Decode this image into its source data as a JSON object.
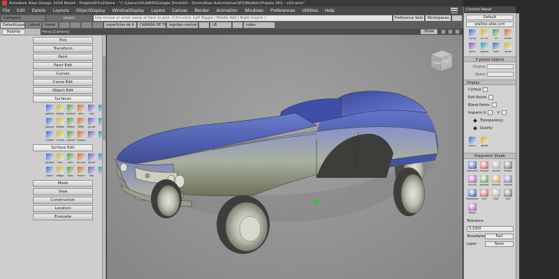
{
  "window": {
    "title": "Autodesk Alias Design 2016 Beta4  -  ProjetoSP2v20wire : \"C:\\Users\\USUARIO\\Google Drive\\00 - Quim\\Alias Automotive\\SP2\\Modelo\\Projeto SP2 - v20.wire\""
  },
  "menu": [
    "File",
    "Edit",
    "Delete",
    "Layouts",
    "ObjectDisplay",
    "WindowDisplay",
    "Layers",
    "Canvas",
    "Render",
    "Animation",
    "Windows",
    "Preferences",
    "Utilities",
    "Help"
  ],
  "toolbar": {
    "category": "Category",
    "object": "object",
    "command_hint": "Use mouse or enter name of item to pick. (Ctrl+click: Left Toggle  | Middle Add | Right Unpick )",
    "preference_sets": "Preference Sets",
    "workspaces": "Workspaces"
  },
  "shelves": [
    "DefaultLayer",
    "Lateral",
    "frente",
    "",
    "",
    "",
    "",
    "superficies da fr",
    "CAMADA DE TRI",
    "logotipo central",
    "",
    "LB",
    "",
    "rodas"
  ],
  "viewport": {
    "label": "Persp [Camera]",
    "show": "Show",
    "cube_labels": [
      "RIGHT",
      "LEFT"
    ]
  },
  "palette": {
    "title": "Palette",
    "sections_top": [
      "Pick",
      "Transform",
      "Paint",
      "Paint Edit",
      "Curves",
      "Curve Edit",
      "Object Edit"
    ],
    "surfaces": {
      "title": "Surfaces",
      "tools": [
        "sphere",
        "planar",
        "revolve",
        "skin",
        "rail",
        "",
        "square",
        "sftillet",
        "fillflnd",
        "fillfln",
        "round",
        "",
        "msdrft",
        "crvnet",
        "cmbsrf",
        "srvpns",
        "",
        ""
      ]
    },
    "surface_edit": {
      "title": "Surface Edit",
      "tools": [
        "project",
        "trim",
        "stch",
        "sh sub",
        "jdhull",
        "",
        "adsrf",
        "ofalgn",
        "tstsr",
        "revsrv",
        "stb",
        ""
      ]
    },
    "sections_bottom": [
      "Mesh",
      "View",
      "Construction",
      "Locators",
      "Evaluate"
    ]
  },
  "control_panel": {
    "title": "Control Panel",
    "default_field": "Default",
    "file_field": "atalhos alias.scm",
    "top_tools": [
      "comp",
      "cv crv",
      "cv",
      "unsim",
      "pnpt",
      "square",
      "save",
      "qrvet"
    ],
    "picked": "0 picked objects",
    "degree_label": "Degree",
    "spans_label": "Spans",
    "display_title": "Display",
    "display_items": [
      "CV/Hull",
      "Edit Points",
      "Blend Points",
      "Isoparm U"
    ],
    "isoparm_v": "V",
    "display_bullets": [
      "Transparency",
      "Quality"
    ],
    "mid_tools": [
      "sfmcv",
      "stedit"
    ],
    "diag_title": "Diagnostic Shade",
    "diag_tools": [
      "shdnorm",
      "mulcol",
      "nsncol",
      "horver",
      "curvcrl",
      "zoelner",
      "thrsnd",
      "clayao",
      "isophotes",
      "vis1",
      "vis2",
      "vis3",
      "fllkoit"
    ],
    "tolerance_label": "Tolerance",
    "tolerance_value": "0.1000",
    "tessellator_label": "Tessellator",
    "tessellator_value": "Fast",
    "layer_label": "Layer",
    "layer_value": "None"
  },
  "colors": {
    "accent": "#d04a2a",
    "car_body": "#5b6fbf",
    "viewport_bg": "#939393"
  }
}
